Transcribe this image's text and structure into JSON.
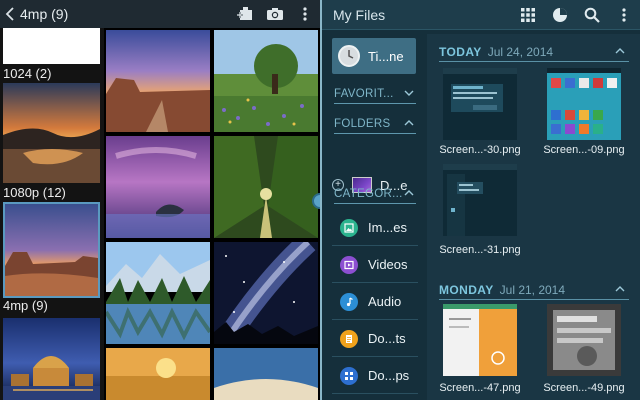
{
  "gallery": {
    "title": "4mp (9)",
    "back_icon": "chevron-left",
    "actions": [
      "add-to-album-icon",
      "camera-icon",
      "more-vert-icon"
    ],
    "albums": [
      {
        "label": ""
      },
      {
        "label": "1024 (2)"
      },
      {
        "label": "1080p (12)"
      },
      {
        "label": "4mp (9)"
      },
      {
        "label": ""
      }
    ]
  },
  "files": {
    "title": "My Files",
    "actions": [
      "grid-view-icon",
      "storage-usage-icon",
      "search-icon",
      "more-vert-icon"
    ],
    "nav": {
      "selected": "Ti...ne",
      "favorites": "FAVORIT...",
      "folders": "FOLDERS",
      "folder_item": "D...e",
      "categories": "CATEGOR...",
      "category_items": [
        {
          "label": "Im...es",
          "color": "#2bb38e",
          "icon": "image-icon"
        },
        {
          "label": "Videos",
          "color": "#8c4fd1",
          "icon": "video-icon"
        },
        {
          "label": "Audio",
          "color": "#2c8fd6",
          "icon": "music-note-icon"
        },
        {
          "label": "Do...ts",
          "color": "#f0a21c",
          "icon": "document-icon"
        },
        {
          "label": "Do...ps",
          "color": "#2d6fd0",
          "icon": "download-icon"
        }
      ]
    },
    "groups": [
      {
        "day": "TODAY",
        "date": "Jul 24, 2014",
        "items": [
          {
            "name": "Screen...-30.png"
          },
          {
            "name": "Screen...-09.png"
          },
          {
            "name": "Screen...-31.png"
          }
        ]
      },
      {
        "day": "MONDAY",
        "date": "Jul 21, 2014",
        "items": [
          {
            "name": "Screen...-47.png"
          },
          {
            "name": "Screen...-49.png"
          }
        ]
      }
    ]
  }
}
